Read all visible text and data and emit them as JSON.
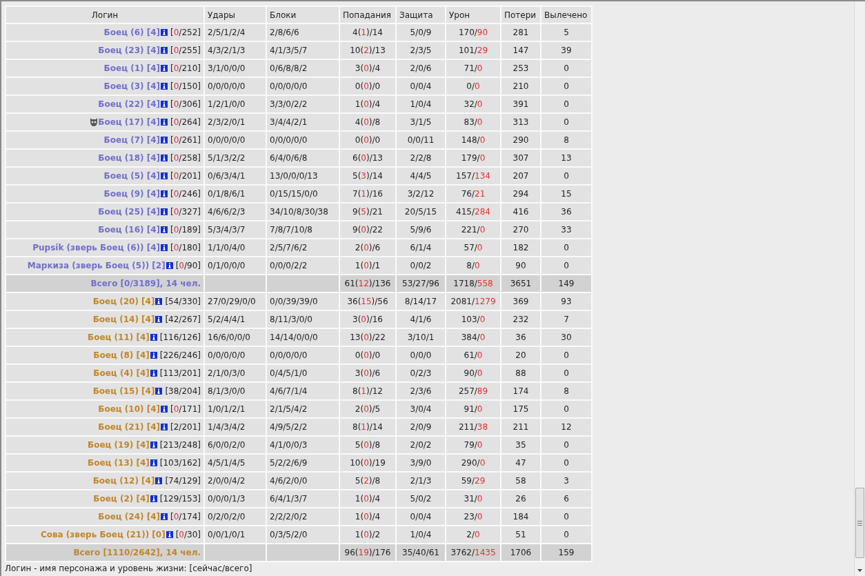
{
  "columns": [
    "Логин",
    "Удары",
    "Блоки",
    "Попадания",
    "Защита",
    "Урон",
    "Потери",
    "Вылечено"
  ],
  "teams": [
    {
      "color": "#6f6fcc",
      "rows": [
        {
          "name": "Боец (6) [4]",
          "hp": [
            "[",
            "0",
            "/252]"
          ],
          "hp_depleted": true,
          "strikes": "2/5/1/2/4",
          "blocks": "2/8/6/6",
          "hits": [
            "4(",
            "1",
            ")/14"
          ],
          "defense": "5/0/9",
          "damage": [
            "170/",
            "90"
          ],
          "losses": "281",
          "healed": "5"
        },
        {
          "name": "Боец (23) [4]",
          "hp": [
            "[",
            "0",
            "/255]"
          ],
          "hp_depleted": true,
          "strikes": "4/3/2/1/3",
          "blocks": "4/1/3/5/7",
          "hits": [
            "10(",
            "2",
            ")/13"
          ],
          "defense": "2/3/5",
          "damage": [
            "101/",
            "29"
          ],
          "losses": "147",
          "healed": "39"
        },
        {
          "name": "Боец (1) [4]",
          "hp": [
            "[",
            "0",
            "/210]"
          ],
          "hp_depleted": true,
          "strikes": "3/1/0/0/0",
          "blocks": "0/6/8/8/2",
          "hits": [
            "3(",
            "0",
            ")/4"
          ],
          "defense": "2/0/6",
          "damage": [
            "71/",
            "0"
          ],
          "losses": "253",
          "healed": "0"
        },
        {
          "name": "Боец (3) [4]",
          "hp": [
            "[",
            "0",
            "/150]"
          ],
          "hp_depleted": true,
          "strikes": "0/0/0/0/0",
          "blocks": "0/0/0/0/0",
          "hits": [
            "0(",
            "0",
            ")/0"
          ],
          "defense": "0/0/4",
          "damage": [
            "0/",
            "0"
          ],
          "losses": "210",
          "healed": "0"
        },
        {
          "name": "Боец (22) [4]",
          "hp": [
            "[",
            "0",
            "/306]"
          ],
          "hp_depleted": true,
          "strikes": "1/2/1/0/0",
          "blocks": "3/3/0/2/2",
          "hits": [
            "1(",
            "0",
            ")/4"
          ],
          "defense": "1/0/4",
          "damage": [
            "32/",
            "0"
          ],
          "losses": "391",
          "healed": "0"
        },
        {
          "name": "Боец (17) [4]",
          "emblem": true,
          "hp": [
            "[",
            "0",
            "/264]"
          ],
          "hp_depleted": true,
          "strikes": "2/3/2/0/1",
          "blocks": "3/4/4/2/1",
          "hits": [
            "4(",
            "0",
            ")/8"
          ],
          "defense": "3/1/5",
          "damage": [
            "83/",
            "0"
          ],
          "losses": "313",
          "healed": "0"
        },
        {
          "name": "Боец (7) [4]",
          "hp": [
            "[",
            "0",
            "/261]"
          ],
          "hp_depleted": true,
          "strikes": "0/0/0/0/0",
          "blocks": "0/0/0/0/0",
          "hits": [
            "0(",
            "0",
            ")/0"
          ],
          "defense": "0/0/11",
          "damage": [
            "148/",
            "0"
          ],
          "losses": "290",
          "healed": "8"
        },
        {
          "name": "Боец (18) [4]",
          "hp": [
            "[",
            "0",
            "/258]"
          ],
          "hp_depleted": true,
          "strikes": "5/1/3/2/2",
          "blocks": "6/4/0/6/8",
          "hits": [
            "6(",
            "0",
            ")/13"
          ],
          "defense": "2/2/8",
          "damage": [
            "179/",
            "0"
          ],
          "losses": "307",
          "healed": "13"
        },
        {
          "name": "Боец (5) [4]",
          "hp": [
            "[",
            "0",
            "/201]"
          ],
          "hp_depleted": true,
          "strikes": "0/6/3/4/1",
          "blocks": "13/0/0/0/13",
          "hits": [
            "5(",
            "3",
            ")/14"
          ],
          "defense": "4/4/5",
          "damage": [
            "157/",
            "134"
          ],
          "losses": "207",
          "healed": "0"
        },
        {
          "name": "Боец (9) [4]",
          "hp": [
            "[",
            "0",
            "/246]"
          ],
          "hp_depleted": true,
          "strikes": "0/1/8/6/1",
          "blocks": "0/15/15/0/0",
          "hits": [
            "7(",
            "1",
            ")/16"
          ],
          "defense": "3/2/12",
          "damage": [
            "76/",
            "21"
          ],
          "losses": "294",
          "healed": "15"
        },
        {
          "name": "Боец (25) [4]",
          "hp": [
            "[",
            "0",
            "/327]"
          ],
          "hp_depleted": true,
          "strikes": "4/6/6/2/3",
          "blocks": "34/10/8/30/38",
          "hits": [
            "9(",
            "5",
            ")/21"
          ],
          "defense": "20/5/15",
          "damage": [
            "415/",
            "284"
          ],
          "losses": "416",
          "healed": "36"
        },
        {
          "name": "Боец (16) [4]",
          "hp": [
            "[",
            "0",
            "/189]"
          ],
          "hp_depleted": true,
          "strikes": "5/3/4/3/7",
          "blocks": "7/8/7/10/8",
          "hits": [
            "9(",
            "0",
            ")/22"
          ],
          "defense": "5/9/6",
          "damage": [
            "221/",
            "0"
          ],
          "losses": "270",
          "healed": "33"
        },
        {
          "name": "Pupsik (зверь Боец (6)) [4]",
          "hp": [
            "[",
            "0",
            "/180]"
          ],
          "hp_depleted": true,
          "strikes": "1/1/0/4/0",
          "blocks": "2/5/7/6/2",
          "hits": [
            "2(",
            "0",
            ")/6"
          ],
          "defense": "6/1/4",
          "damage": [
            "57/",
            "0"
          ],
          "losses": "182",
          "healed": "0"
        },
        {
          "name": "Маркиза (зверь Боец (5)) [2]",
          "hp": [
            "[",
            "0",
            "/90]"
          ],
          "hp_depleted": true,
          "strikes": "0/1/0/0/0",
          "blocks": "0/0/0/2/2",
          "hits": [
            "1(",
            "0",
            ")/1"
          ],
          "defense": "0/0/2",
          "damage": [
            "8/",
            "0"
          ],
          "losses": "90",
          "healed": "0"
        }
      ],
      "total": {
        "label": "Всего [0/3189], 14 чел.",
        "hits": [
          "61(",
          "12",
          ")/136"
        ],
        "defense": "53/27/96",
        "damage": [
          "1718/",
          "558"
        ],
        "losses": "3651",
        "healed": "149"
      }
    },
    {
      "color": "#c0862b",
      "rows": [
        {
          "name": "Боец (20) [4]",
          "hp": [
            "[",
            "54",
            "/330]"
          ],
          "hp_depleted": false,
          "strikes": "27/0/29/0/0",
          "blocks": "0/0/39/39/0",
          "hits": [
            "36(",
            "15",
            ")/56"
          ],
          "defense": "8/14/17",
          "damage": [
            "2081/",
            "1279"
          ],
          "losses": "369",
          "healed": "93"
        },
        {
          "name": "Боец (14) [4]",
          "hp": [
            "[",
            "42",
            "/267]"
          ],
          "hp_depleted": false,
          "strikes": "5/2/4/4/1",
          "blocks": "8/11/3/0/0",
          "hits": [
            "3(",
            "0",
            ")/16"
          ],
          "defense": "4/1/6",
          "damage": [
            "103/",
            "0"
          ],
          "losses": "232",
          "healed": "7"
        },
        {
          "name": "Боец (11) [4]",
          "hp": [
            "[",
            "116",
            "/126]"
          ],
          "hp_depleted": false,
          "strikes": "16/6/0/0/0",
          "blocks": "14/14/0/0/0",
          "hits": [
            "13(",
            "0",
            ")/22"
          ],
          "defense": "3/10/1",
          "damage": [
            "384/",
            "0"
          ],
          "losses": "36",
          "healed": "30"
        },
        {
          "name": "Боец (8) [4]",
          "hp": [
            "[",
            "226",
            "/246]"
          ],
          "hp_depleted": false,
          "strikes": "0/0/0/0/0",
          "blocks": "0/0/0/0/0",
          "hits": [
            "0(",
            "0",
            ")/0"
          ],
          "defense": "0/0/0",
          "damage": [
            "61/",
            "0"
          ],
          "losses": "20",
          "healed": "0"
        },
        {
          "name": "Боец (4) [4]",
          "hp": [
            "[",
            "113",
            "/201]"
          ],
          "hp_depleted": false,
          "strikes": "2/1/0/3/0",
          "blocks": "0/4/5/1/0",
          "hits": [
            "3(",
            "0",
            ")/6"
          ],
          "defense": "0/2/3",
          "damage": [
            "90/",
            "0"
          ],
          "losses": "88",
          "healed": "0"
        },
        {
          "name": "Боец (15) [4]",
          "hp": [
            "[",
            "38",
            "/204]"
          ],
          "hp_depleted": false,
          "strikes": "8/1/3/0/0",
          "blocks": "4/6/7/1/4",
          "hits": [
            "8(",
            "1",
            ")/12"
          ],
          "defense": "2/3/6",
          "damage": [
            "257/",
            "89"
          ],
          "losses": "174",
          "healed": "8"
        },
        {
          "name": "Боец (10) [4]",
          "hp": [
            "[",
            "0",
            "/171]"
          ],
          "hp_depleted": true,
          "strikes": "1/0/1/2/1",
          "blocks": "2/1/5/4/2",
          "hits": [
            "2(",
            "0",
            ")/5"
          ],
          "defense": "3/0/4",
          "damage": [
            "91/",
            "0"
          ],
          "losses": "175",
          "healed": "0"
        },
        {
          "name": "Боец (21) [4]",
          "hp": [
            "[",
            "2",
            "/201]"
          ],
          "hp_depleted": false,
          "strikes": "1/4/3/4/2",
          "blocks": "4/9/5/2/2",
          "hits": [
            "8(",
            "1",
            ")/14"
          ],
          "defense": "2/0/9",
          "damage": [
            "211/",
            "38"
          ],
          "losses": "211",
          "healed": "12"
        },
        {
          "name": "Боец (19) [4]",
          "hp": [
            "[",
            "213",
            "/248]"
          ],
          "hp_depleted": false,
          "strikes": "6/0/0/2/0",
          "blocks": "4/1/0/0/3",
          "hits": [
            "5(",
            "0",
            ")/8"
          ],
          "defense": "2/0/2",
          "damage": [
            "79/",
            "0"
          ],
          "losses": "35",
          "healed": "0"
        },
        {
          "name": "Боец (13) [4]",
          "hp": [
            "[",
            "103",
            "/162]"
          ],
          "hp_depleted": false,
          "strikes": "4/5/1/4/5",
          "blocks": "5/2/2/6/9",
          "hits": [
            "10(",
            "0",
            ")/19"
          ],
          "defense": "3/9/0",
          "damage": [
            "290/",
            "0"
          ],
          "losses": "47",
          "healed": "0"
        },
        {
          "name": "Боец (12) [4]",
          "hp": [
            "[",
            "74",
            "/129]"
          ],
          "hp_depleted": false,
          "strikes": "2/0/0/4/2",
          "blocks": "4/6/2/0/0",
          "hits": [
            "5(",
            "2",
            ")/8"
          ],
          "defense": "2/1/3",
          "damage": [
            "59/",
            "29"
          ],
          "losses": "58",
          "healed": "3"
        },
        {
          "name": "Боец (2) [4]",
          "hp": [
            "[",
            "129",
            "/153]"
          ],
          "hp_depleted": false,
          "strikes": "0/0/0/1/3",
          "blocks": "6/4/1/3/7",
          "hits": [
            "1(",
            "0",
            ")/4"
          ],
          "defense": "5/0/2",
          "damage": [
            "31/",
            "0"
          ],
          "losses": "26",
          "healed": "6"
        },
        {
          "name": "Боец (24) [4]",
          "hp": [
            "[",
            "0",
            "/174]"
          ],
          "hp_depleted": true,
          "strikes": "0/2/0/2/0",
          "blocks": "2/2/2/0/2",
          "hits": [
            "1(",
            "0",
            ")/4"
          ],
          "defense": "0/0/4",
          "damage": [
            "23/",
            "0"
          ],
          "losses": "184",
          "healed": "0"
        },
        {
          "name": "Сова (зверь Боец (21)) [0]",
          "hp": [
            "[",
            "0",
            "/30]"
          ],
          "hp_depleted": true,
          "strikes": "0/0/1/0/1",
          "blocks": "0/3/5/2/0",
          "hits": [
            "1(",
            "0",
            ")/2"
          ],
          "defense": "1/0/4",
          "damage": [
            "2/",
            "0"
          ],
          "losses": "51",
          "healed": "0"
        }
      ],
      "total": {
        "label": "Всего [1110/2642], 14 чел.",
        "hits": [
          "96(",
          "19",
          ")/176"
        ],
        "defense": "35/40/61",
        "damage": [
          "3762/",
          "1435"
        ],
        "losses": "1706",
        "healed": "159"
      }
    }
  ],
  "legend": "Логин - имя персонажа и уровень жизни: [сейчас/всего]"
}
